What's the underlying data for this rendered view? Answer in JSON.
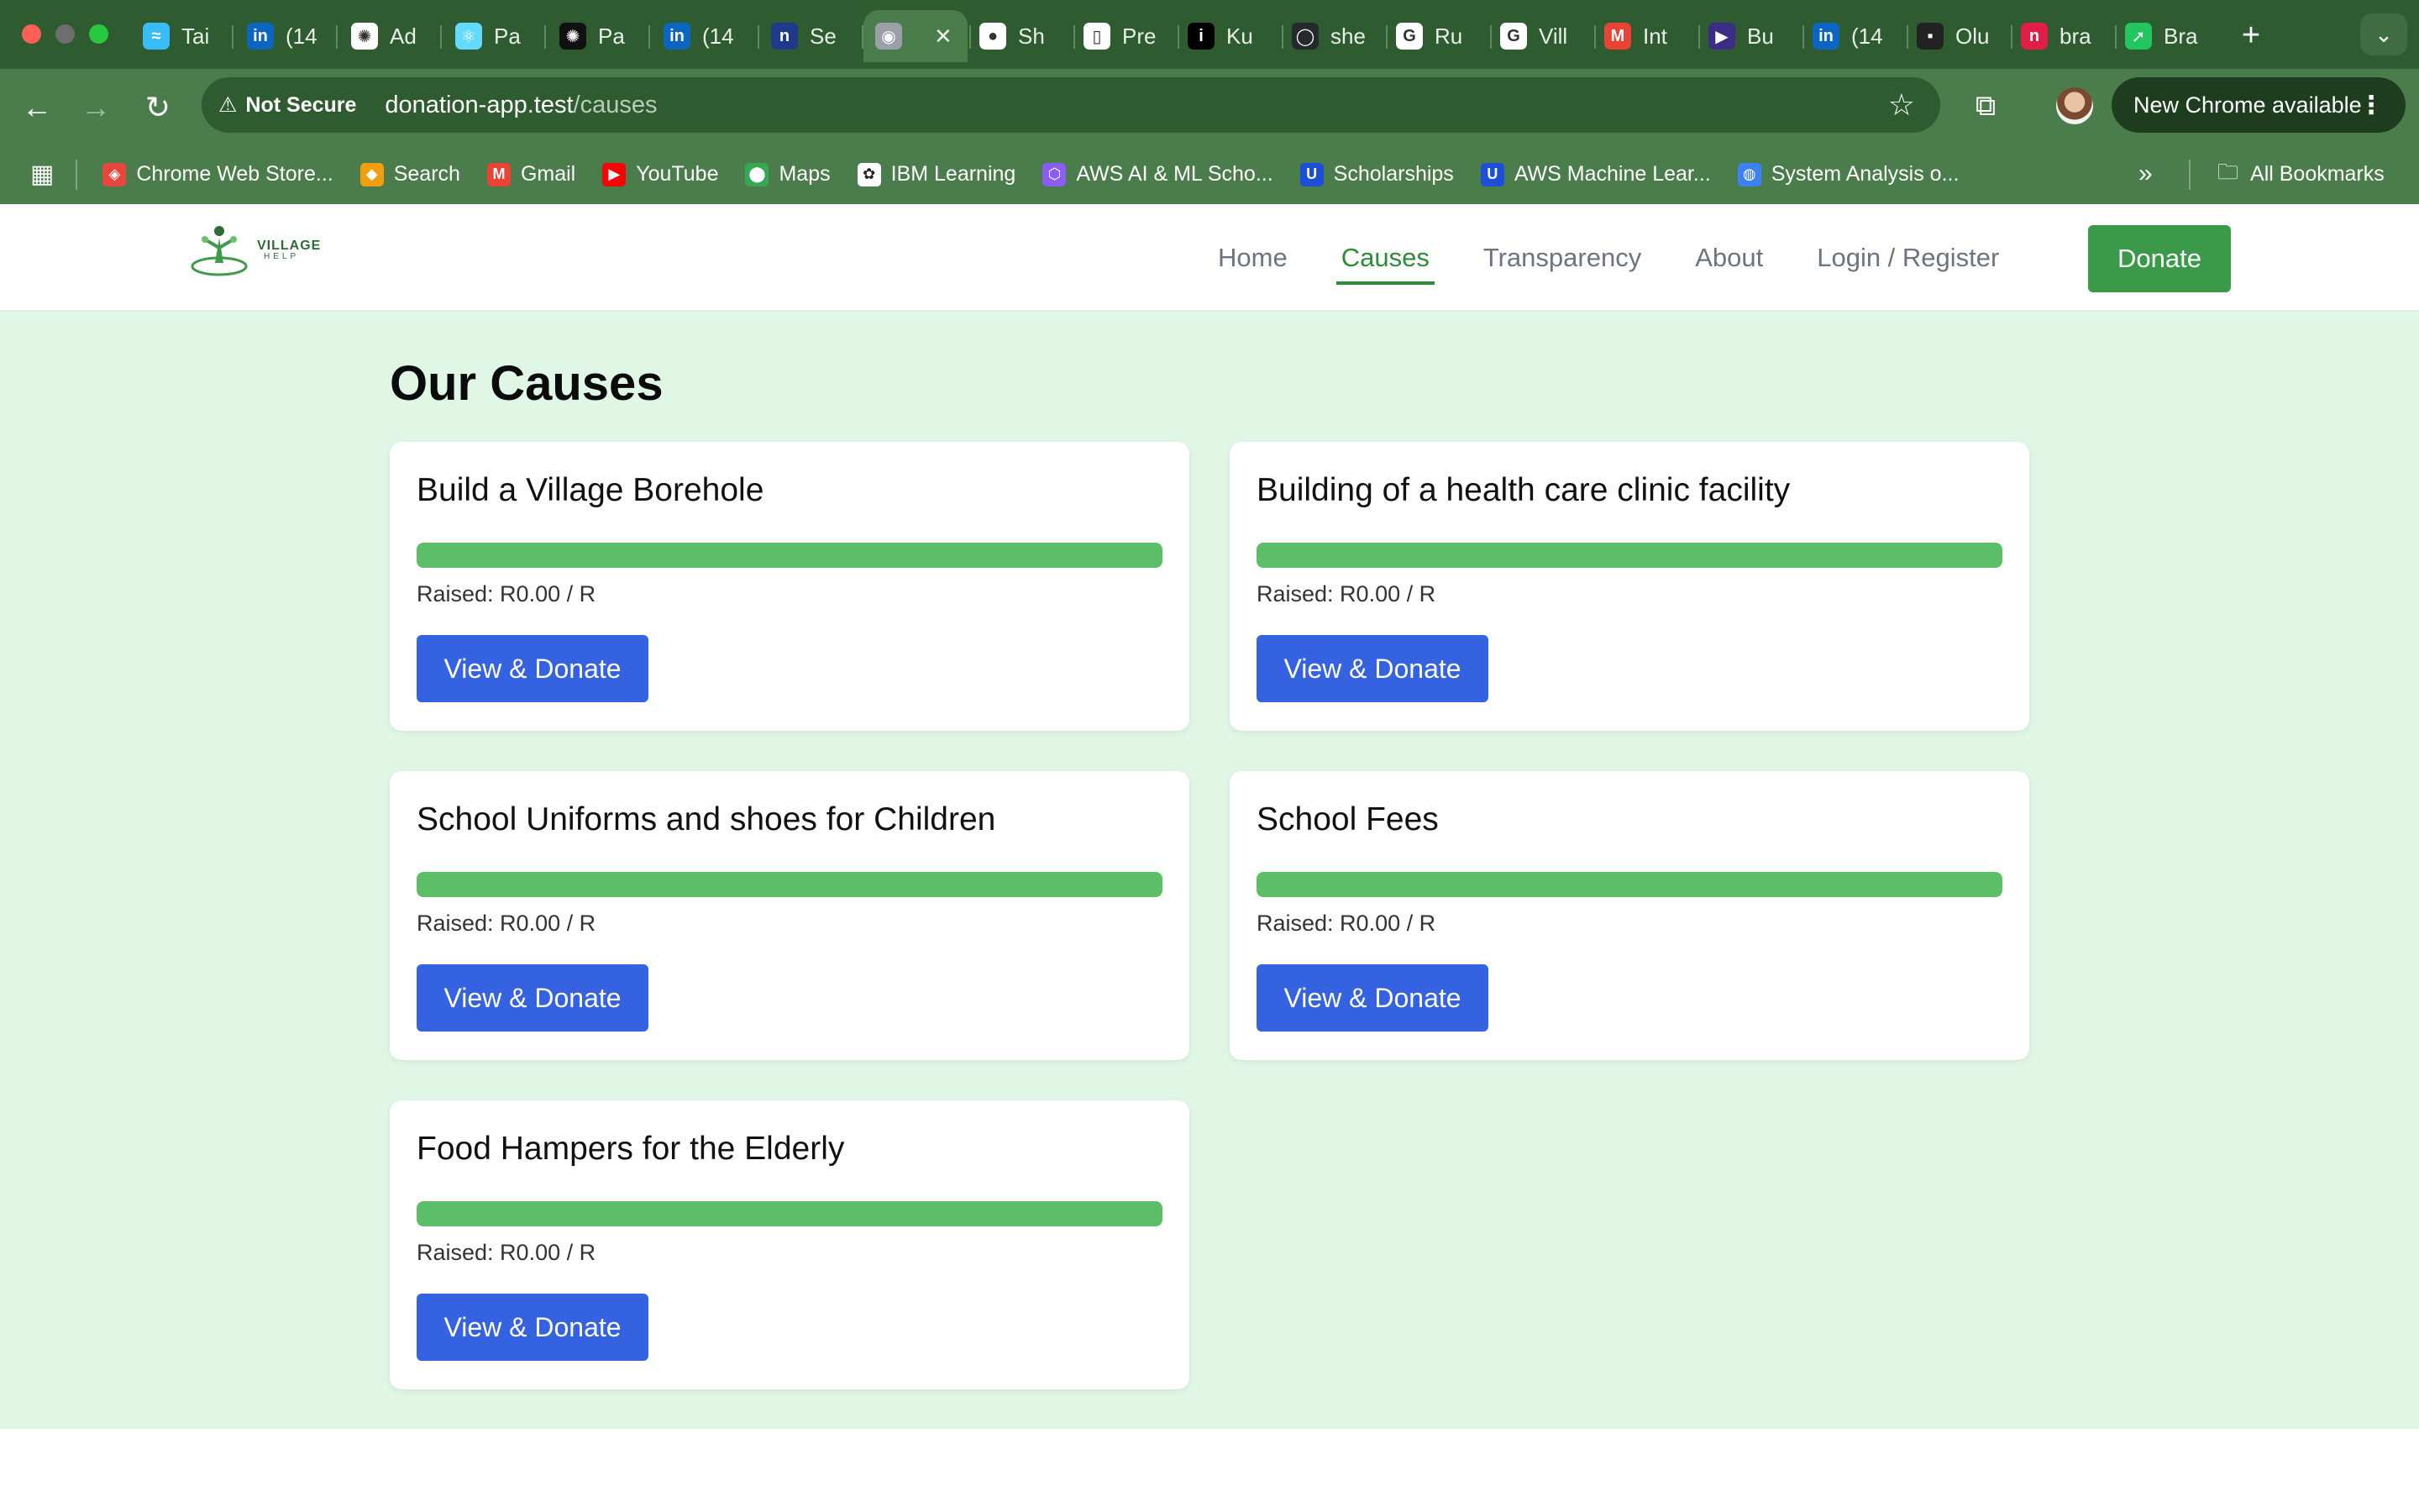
{
  "browser": {
    "tabs": [
      {
        "label": "Tai",
        "icon": "tailwind-icon",
        "color": "#38bdf8"
      },
      {
        "label": "(14",
        "icon": "linkedin-icon",
        "color": "#0a66c2"
      },
      {
        "label": "Ad",
        "icon": "openai-icon",
        "color": "#ffffff"
      },
      {
        "label": "Pa",
        "icon": "react-icon",
        "color": "#61dafb"
      },
      {
        "label": "Pa",
        "icon": "openai-icon",
        "color": "#111111"
      },
      {
        "label": "(14",
        "icon": "linkedin-icon",
        "color": "#0a66c2"
      },
      {
        "label": "Se",
        "icon": "n-icon",
        "color": "#1e3a8a"
      },
      {
        "label": "",
        "icon": "globe-icon",
        "color": "#9aa0a6"
      },
      {
        "label": "Sh",
        "icon": "dot-icon",
        "color": "#ffffff"
      },
      {
        "label": "Pre",
        "icon": "doc-icon",
        "color": "#ffffff"
      },
      {
        "label": "Ku",
        "icon": "info-icon",
        "color": "#000000"
      },
      {
        "label": "she",
        "icon": "github-icon",
        "color": "#24292e"
      },
      {
        "label": "Ru",
        "icon": "google-icon",
        "color": "#ffffff"
      },
      {
        "label": "Vill",
        "icon": "google-icon",
        "color": "#ffffff"
      },
      {
        "label": "Int",
        "icon": "gmail-icon",
        "color": "#ea4335"
      },
      {
        "label": "Bu",
        "icon": "play-icon",
        "color": "#3b2c85"
      },
      {
        "label": "(14",
        "icon": "linkedin-icon",
        "color": "#0a66c2"
      },
      {
        "label": "Olu",
        "icon": "app-icon",
        "color": "#222222"
      },
      {
        "label": "bra",
        "icon": "n-icon",
        "color": "#e11d48"
      },
      {
        "label": "Bra",
        "icon": "arrow-icon",
        "color": "#22c55e"
      }
    ],
    "address": {
      "security": "Not Secure",
      "host": "donation-app.test",
      "path": "/causes"
    },
    "update_label": "New Chrome available",
    "bookmarks": [
      {
        "label": "Chrome Web Store...",
        "icon": "chrome-web-store-icon",
        "color": "#e8453c"
      },
      {
        "label": "Search",
        "icon": "search-engine-icon",
        "color": "#f59e0b"
      },
      {
        "label": "Gmail",
        "icon": "gmail-icon",
        "color": "#ea4335"
      },
      {
        "label": "YouTube",
        "icon": "youtube-icon",
        "color": "#ff0000"
      },
      {
        "label": "Maps",
        "icon": "maps-icon",
        "color": "#34a853"
      },
      {
        "label": "IBM Learning",
        "icon": "ibm-icon",
        "color": "#ffffff"
      },
      {
        "label": "AWS AI & ML Scho...",
        "icon": "aws-icon",
        "color": "#8b5cf6"
      },
      {
        "label": "Scholarships",
        "icon": "udacity-icon",
        "color": "#1d4ed8"
      },
      {
        "label": "AWS Machine Lear...",
        "icon": "udacity-icon",
        "color": "#1d4ed8"
      },
      {
        "label": "System Analysis o...",
        "icon": "globe-icon",
        "color": "#3b82f6"
      }
    ],
    "all_bookmarks": "All Bookmarks"
  },
  "site": {
    "logo": {
      "line1": "VILLAGE",
      "line2": "HELP"
    },
    "nav": [
      "Home",
      "Causes",
      "Transparency",
      "About",
      "Login / Register"
    ],
    "active_nav": "Causes",
    "donate_label": "Donate",
    "page_title": "Our Causes",
    "causes": [
      {
        "title": "Build a Village Borehole",
        "raised": "Raised: R0.00 / R",
        "progress": 1.0,
        "button": "View & Donate"
      },
      {
        "title": "Building of a health care clinic facility",
        "raised": "Raised: R0.00 / R",
        "progress": 1.0,
        "button": "View & Donate"
      },
      {
        "title": "School Uniforms and shoes for Children",
        "raised": "Raised: R0.00 / R",
        "progress": 1.0,
        "button": "View & Donate"
      },
      {
        "title": "School Fees",
        "raised": "Raised: R0.00 / R",
        "progress": 1.0,
        "button": "View & Donate"
      },
      {
        "title": "Food Hampers for the Elderly",
        "raised": "Raised: R0.00 / R",
        "progress": 1.0,
        "button": "View & Donate"
      }
    ],
    "colors": {
      "brand_green": "#3b9a4a",
      "progress_green": "#5cbf67",
      "button_blue": "#3562e0",
      "background": "#e1f7e6"
    }
  }
}
